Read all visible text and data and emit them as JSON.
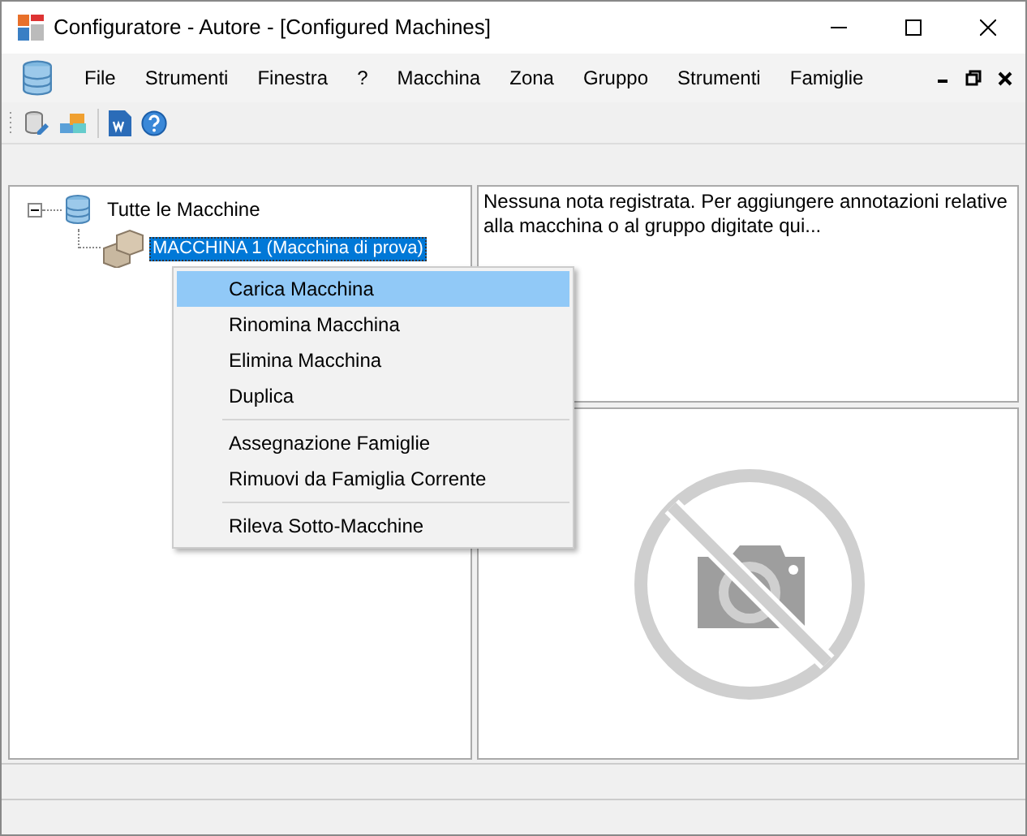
{
  "window": {
    "title": "Configuratore - Autore - [Configured Machines]"
  },
  "menu_bar": [
    "File",
    "Strumenti",
    "Finestra",
    "?",
    "Macchina",
    "Zona",
    "Gruppo",
    "Strumenti",
    "Famiglie"
  ],
  "tree": {
    "label": "Tutte le Macchine",
    "expanded": true,
    "children": [
      {
        "label": "MACCHINA 1 (Macchina di prova)",
        "selected": true
      }
    ]
  },
  "notes": {
    "placeholder": "Nessuna nota registrata. Per aggiungere annotazioni relative alla macchina o al gruppo digitate qui..."
  },
  "context_menu": [
    {
      "kind": "item",
      "label": "Carica Macchina",
      "selected": true
    },
    {
      "kind": "item",
      "label": "Rinomina Macchina",
      "selected": false
    },
    {
      "kind": "item",
      "label": "Elimina Macchina",
      "selected": false
    },
    {
      "kind": "item",
      "label": "Duplica",
      "selected": false
    },
    {
      "kind": "separator"
    },
    {
      "kind": "item",
      "label": "Assegnazione Famiglie",
      "selected": false
    },
    {
      "kind": "item",
      "label": "Rimuovi da Famiglia Corrente",
      "selected": false
    },
    {
      "kind": "separator"
    },
    {
      "kind": "item",
      "label": "Rileva Sotto-Macchine",
      "selected": false
    }
  ]
}
